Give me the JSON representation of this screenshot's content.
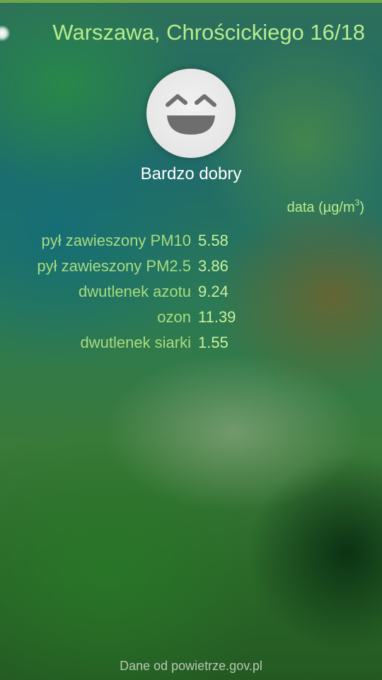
{
  "header": {
    "location": "Warszawa, Chrościckiego 16/18"
  },
  "status": {
    "icon": "laughing-smiley-icon",
    "label": "Bardzo dobry"
  },
  "unit": {
    "prefix": "data (µg/m",
    "superscript": "3",
    "suffix": ")"
  },
  "readings": [
    {
      "name": "pył zawieszony PM10",
      "value": "5.58"
    },
    {
      "name": "pył zawieszony PM2.5",
      "value": "3.86"
    },
    {
      "name": "dwutlenek azotu",
      "value": "9.24"
    },
    {
      "name": "ozon",
      "value": "11.39"
    },
    {
      "name": "dwutlenek siarki",
      "value": "1.55"
    }
  ],
  "footer": {
    "source": "Dane od powietrze.gov.pl"
  },
  "colors": {
    "accent": "#b7ec8e",
    "top_bar": "#6fa84a"
  }
}
